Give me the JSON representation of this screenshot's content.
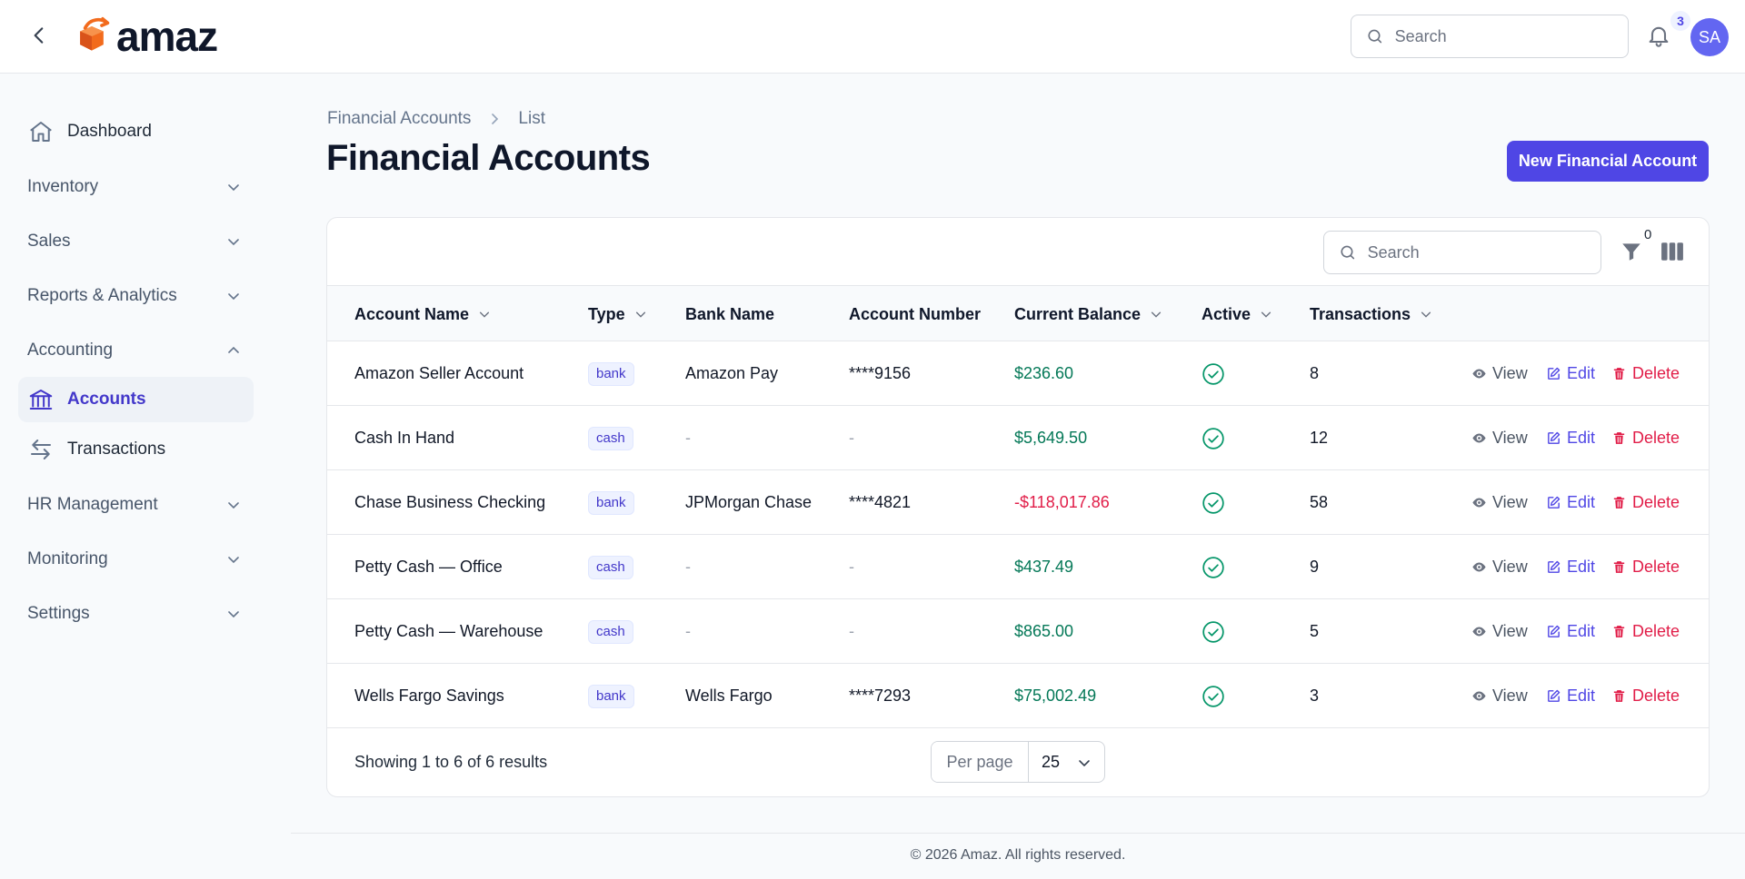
{
  "app": {
    "logo_text": "amaz",
    "search_placeholder": "Search",
    "notification_count": "3",
    "user_initials": "SA",
    "brand_color": "#4f46e5"
  },
  "sidebar": {
    "items": [
      {
        "label": "Dashboard",
        "icon": "home-icon"
      },
      {
        "label": "Inventory",
        "icon": "chevron-down-icon"
      },
      {
        "label": "Sales",
        "icon": "chevron-down-icon"
      },
      {
        "label": "Reports & Analytics",
        "icon": "chevron-down-icon"
      },
      {
        "label": "Accounting",
        "icon": "chevron-up-icon"
      },
      {
        "label": "Accounts",
        "icon": "bank-icon",
        "active": true
      },
      {
        "label": "Transactions",
        "icon": "arrows-exchange-icon"
      },
      {
        "label": "HR Management",
        "icon": "chevron-down-icon"
      },
      {
        "label": "Monitoring",
        "icon": "chevron-down-icon"
      },
      {
        "label": "Settings",
        "icon": "chevron-down-icon"
      }
    ]
  },
  "breadcrumb": {
    "parent": "Financial Accounts",
    "current": "List"
  },
  "page": {
    "title": "Financial Accounts",
    "new_button": "New Financial Account"
  },
  "table": {
    "search_placeholder": "Search",
    "filter_count": "0",
    "columns": [
      "Account Name",
      "Type",
      "Bank Name",
      "Account Number",
      "Current Balance",
      "Active",
      "Transactions"
    ],
    "rows": [
      {
        "name": "Amazon Seller Account",
        "type": "bank",
        "bank": "Amazon Pay",
        "number": "****9156",
        "balance": "$236.60",
        "balance_sign": "positive",
        "active": true,
        "transactions": "8"
      },
      {
        "name": "Cash In Hand",
        "type": "cash",
        "bank": "-",
        "number": "-",
        "balance": "$5,649.50",
        "balance_sign": "positive",
        "active": true,
        "transactions": "12"
      },
      {
        "name": "Chase Business Checking",
        "type": "bank",
        "bank": "JPMorgan Chase",
        "number": "****4821",
        "balance": "-$118,017.86",
        "balance_sign": "negative",
        "active": true,
        "transactions": "58"
      },
      {
        "name": "Petty Cash — Office",
        "type": "cash",
        "bank": "-",
        "number": "-",
        "balance": "$437.49",
        "balance_sign": "positive",
        "active": true,
        "transactions": "9"
      },
      {
        "name": "Petty Cash — Warehouse",
        "type": "cash",
        "bank": "-",
        "number": "-",
        "balance": "$865.00",
        "balance_sign": "positive",
        "active": true,
        "transactions": "5"
      },
      {
        "name": "Wells Fargo Savings",
        "type": "bank",
        "bank": "Wells Fargo",
        "number": "****7293",
        "balance": "$75,002.49",
        "balance_sign": "positive",
        "active": true,
        "transactions": "3"
      }
    ],
    "actions": {
      "view": "View",
      "edit": "Edit",
      "delete": "Delete"
    },
    "summary": "Showing 1 to 6 of 6 results",
    "per_page_label": "Per page",
    "per_page_value": "25"
  },
  "footer": {
    "copyright": "© 2026 Amaz. All rights reserved."
  }
}
